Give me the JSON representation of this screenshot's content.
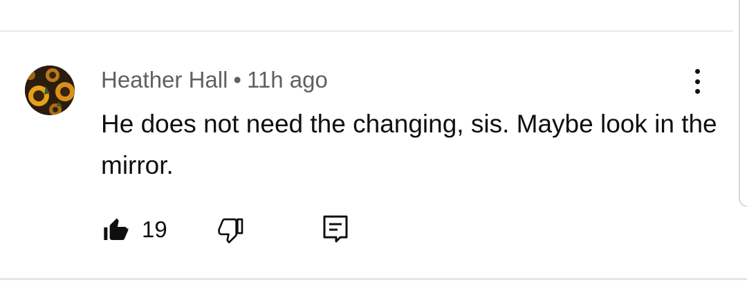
{
  "comment": {
    "author": "Heather Hall",
    "separator": "•",
    "time": "11h ago",
    "text": "He does not need the changing, sis. Maybe look in the mirror.",
    "like_count": "19"
  },
  "icons": {
    "avatar": "sunflower-avatar",
    "more": "more-vert-icon",
    "like": "thumb-up-filled-icon",
    "dislike": "thumb-down-outline-icon",
    "reply": "reply-comment-icon"
  }
}
